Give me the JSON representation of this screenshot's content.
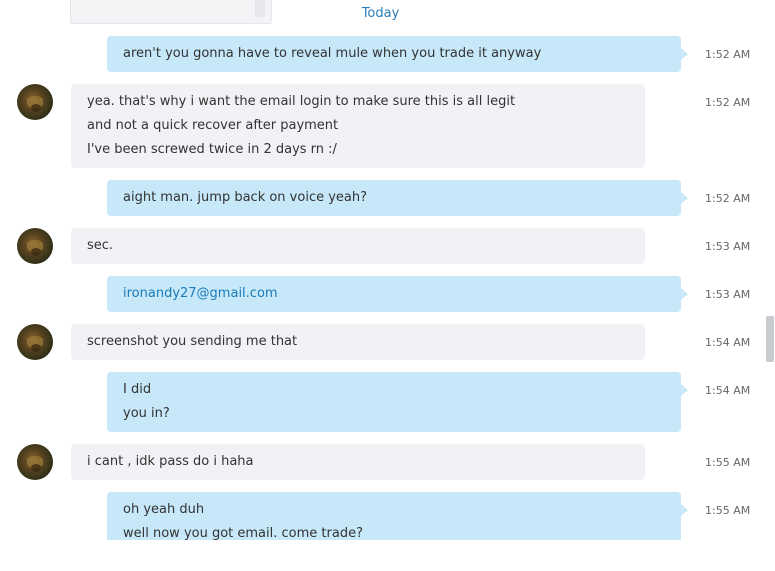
{
  "date_divider": "Today",
  "messages": [
    {
      "dir": "out",
      "lines": [
        "aren't you gonna have to reveal mule when you trade it anyway"
      ],
      "time": "1:52 AM"
    },
    {
      "dir": "in",
      "lines": [
        "yea. that's why i want the email login to make sure this is all legit",
        "and not a quick recover after payment",
        "I've been screwed twice in 2 days rn :/"
      ],
      "time": "1:52 AM"
    },
    {
      "dir": "out",
      "lines": [
        "aight man. jump back on voice yeah?"
      ],
      "time": "1:52 AM"
    },
    {
      "dir": "in",
      "lines": [
        "sec."
      ],
      "time": "1:53 AM"
    },
    {
      "dir": "out",
      "lines": [
        "ironandy27@gmail.com"
      ],
      "time": "1:53 AM",
      "link": true
    },
    {
      "dir": "in",
      "lines": [
        "screenshot you sending me that"
      ],
      "time": "1:54 AM"
    },
    {
      "dir": "out",
      "lines": [
        "I did",
        "you in?"
      ],
      "time": "1:54 AM"
    },
    {
      "dir": "in",
      "lines": [
        "i cant , idk pass do i haha"
      ],
      "time": "1:55 AM"
    },
    {
      "dir": "out",
      "lines": [
        "oh yeah duh",
        "well now you got email. come trade?"
      ],
      "time": "1:55 AM"
    }
  ]
}
